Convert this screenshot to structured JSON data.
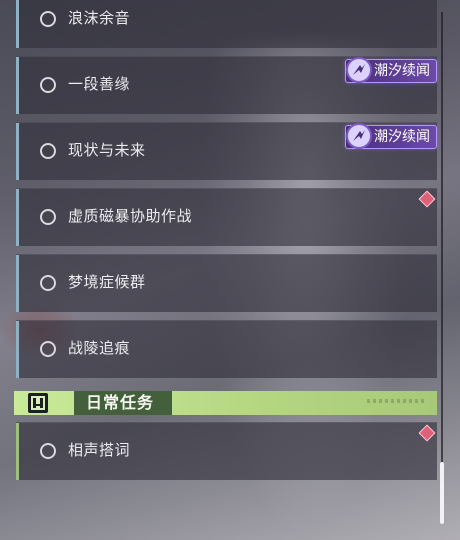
{
  "quests": [
    {
      "label": "浪沫余音",
      "badge": null,
      "alert": false
    },
    {
      "label": "一段善缘",
      "badge": "潮汐续闻",
      "alert": false
    },
    {
      "label": "现状与未来",
      "badge": "潮汐续闻",
      "alert": false
    },
    {
      "label": "虚质磁暴协助作战",
      "badge": null,
      "alert": true
    },
    {
      "label": "梦境症候群",
      "badge": null,
      "alert": false
    },
    {
      "label": "战陵追痕",
      "badge": null,
      "alert": false
    }
  ],
  "daily_section": {
    "title": "日常任务",
    "quests": [
      {
        "label": "相声搭词",
        "alert": true
      }
    ]
  },
  "colors": {
    "main_accent": "#8eb1c4",
    "daily_accent": "#9ec07a",
    "badge_purple": "#6b4aa8",
    "alert_red": "#e0607a"
  }
}
